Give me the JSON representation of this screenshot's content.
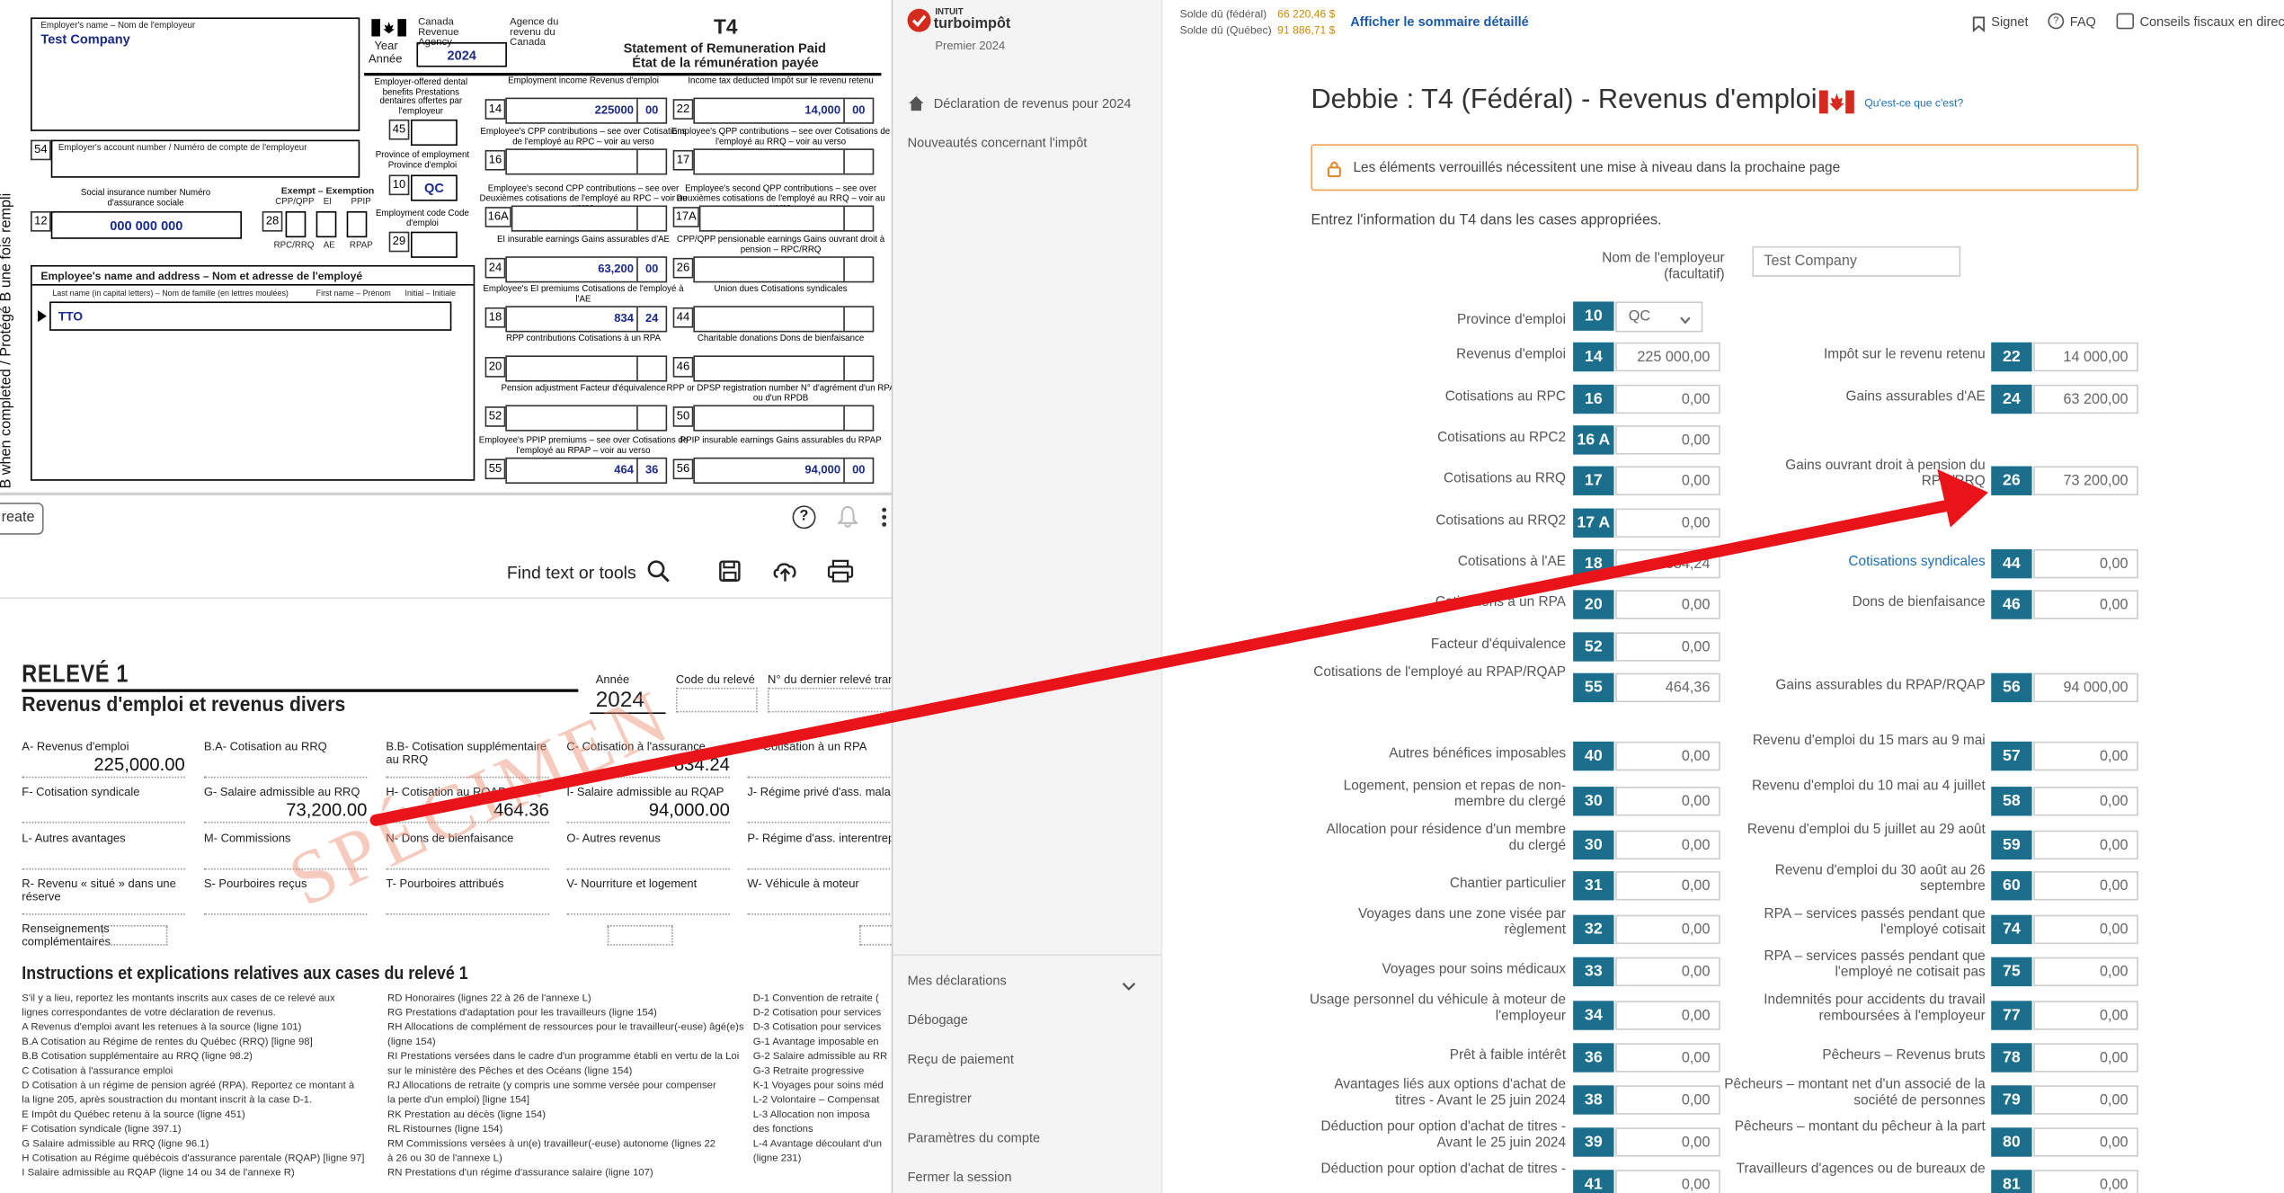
{
  "t4": {
    "employer_label": "Employer's name – Nom de l'employeur",
    "employer_name": "Test Company",
    "agency_en": "Canada Revenue Agency",
    "agency_fr": "Agence du revenu du Canada",
    "year_label_en": "Year",
    "year_label_fr": "Année",
    "year": "2024",
    "form_code": "T4",
    "title_en": "Statement of Remuneration Paid",
    "title_fr": "État de la rémunération payée",
    "side_text": "Protected B when completed / Protégé B une fois rempli",
    "account_label": "Employer's account number / Numéro de compte de l'employeur",
    "sin_label": "Social insurance number Numéro d'assurance sociale",
    "sin": "000 000 000",
    "exempt_label": "Exempt – Exemption",
    "exempt_cols": [
      "CPP/QPP",
      "EI",
      "PPIP"
    ],
    "exempt_cols_fr": [
      "RPC/RRQ",
      "AE",
      "RPAP"
    ],
    "dental_label": "Employer-offered dental benefits Prestations dentaires offertes par l'employeur",
    "province_label": "Province of employment Province d'emploi",
    "province": "QC",
    "empcode_label": "Employment code Code d'emploi",
    "name_addr_label": "Employee's name and address – Nom et adresse de l'employé",
    "lastname_label": "Last name (in capital letters) – Nom de famille (en lettres moulées)",
    "firstname_label": "First name – Prénom",
    "initial_label": "Initial – Initiale",
    "employee_lastname": "TTO",
    "boxes": [
      {
        "num": "14",
        "label": "Employment income Revenus d'emploi",
        "dollars": "225000",
        "cents": "00"
      },
      {
        "num": "22",
        "label": "Income tax deducted Impôt sur le revenu retenu",
        "dollars": "14,000",
        "cents": "00"
      },
      {
        "num": "16",
        "label": "Employee's CPP contributions – see over Cotisations de l'employé au RPC – voir au verso",
        "dollars": "",
        "cents": ""
      },
      {
        "num": "17",
        "label": "Employee's QPP contributions – see over Cotisations de l'employé au RRQ – voir au verso",
        "dollars": "",
        "cents": ""
      },
      {
        "num": "16A",
        "label": "Employee's second CPP contributions – see over Deuxièmes cotisations de l'employé au RPC – voir au verso",
        "dollars": "",
        "cents": ""
      },
      {
        "num": "17A",
        "label": "Employee's second QPP contributions – see over Deuxièmes cotisations de l'employé au RRQ – voir au verso",
        "dollars": "",
        "cents": ""
      },
      {
        "num": "24",
        "label": "EI insurable earnings Gains assurables d'AE",
        "dollars": "63,200",
        "cents": "00"
      },
      {
        "num": "26",
        "label": "CPP/QPP pensionable earnings Gains ouvrant droit à pension – RPC/RRQ",
        "dollars": "",
        "cents": ""
      },
      {
        "num": "18",
        "label": "Employee's EI premiums Cotisations de l'employé à l'AE",
        "dollars": "834",
        "cents": "24"
      },
      {
        "num": "44",
        "label": "Union dues Cotisations syndicales",
        "dollars": "",
        "cents": ""
      },
      {
        "num": "20",
        "label": "RPP contributions Cotisations à un RPA",
        "dollars": "",
        "cents": ""
      },
      {
        "num": "46",
        "label": "Charitable donations Dons de bienfaisance",
        "dollars": "",
        "cents": ""
      },
      {
        "num": "52",
        "label": "Pension adjustment Facteur d'équivalence",
        "dollars": "",
        "cents": ""
      },
      {
        "num": "50",
        "label": "RPP or DPSP registration number N° d'agrément d'un RPA ou d'un RPDB",
        "dollars": "",
        "cents": ""
      },
      {
        "num": "55",
        "label": "Employee's PPIP premiums – see over Cotisations de l'employé au RPAP – voir au verso",
        "dollars": "464",
        "cents": "36"
      },
      {
        "num": "56",
        "label": "PPIP insurable earnings Gains assurables du RPAP",
        "dollars": "94,000",
        "cents": "00"
      }
    ],
    "small_boxes": [
      "54",
      "12",
      "28",
      "45",
      "10",
      "29"
    ]
  },
  "viewer": {
    "create_label": "reate",
    "find_label": "Find text or tools"
  },
  "releve": {
    "title": "RELEVÉ 1",
    "subtitle": "Revenus d'emploi et revenus divers",
    "year_label": "Année",
    "year": "2024",
    "code_label": "Code du relevé",
    "last_label": "N° du dernier relevé trans",
    "watermark": "SPÉCIMEN",
    "fields": [
      {
        "label": "A- Revenus d'emploi",
        "value": "225,000.00"
      },
      {
        "label": "B.A- Cotisation au RRQ",
        "value": ""
      },
      {
        "label": "B.B- Cotisation supplémentaire au RRQ",
        "value": ""
      },
      {
        "label": "C- Cotisation à l'assurance",
        "value": "834.24"
      },
      {
        "label": "D- Cotisation à un RPA",
        "value": ""
      },
      {
        "label": "F- Cotisation syndicale",
        "value": ""
      },
      {
        "label": "G- Salaire admissible au RRQ",
        "value": "73,200.00"
      },
      {
        "label": "H- Cotisation au RQAP",
        "value": "464.36"
      },
      {
        "label": "I- Salaire admissible au RQAP",
        "value": "94,000.00"
      },
      {
        "label": "J- Régime privé d'ass. maladie",
        "value": ""
      },
      {
        "label": "L- Autres avantages",
        "value": ""
      },
      {
        "label": "M- Commissions",
        "value": ""
      },
      {
        "label": "N- Dons de bienfaisance",
        "value": ""
      },
      {
        "label": "O- Autres revenus",
        "value": ""
      },
      {
        "label": "P- Régime d'ass. interentrepri",
        "value": ""
      },
      {
        "label": "R- Revenu « situé » dans une réserve",
        "value": ""
      },
      {
        "label": "S- Pourboires reçus",
        "value": ""
      },
      {
        "label": "T- Pourboires attribués",
        "value": ""
      },
      {
        "label": "V- Nourriture et logement",
        "value": ""
      },
      {
        "label": "W- Véhicule à moteur",
        "value": ""
      }
    ],
    "extra_label": "Renseignements complémentaires",
    "instr_title": "Instructions et explications relatives aux cases du relevé 1",
    "instr_col1": [
      "S'il y a lieu, reportez les montants inscrits aux cases de ce relevé aux",
      "lignes correspondantes de votre déclaration de revenus.",
      "A    Revenus d'emploi avant les retenues à la source (ligne 101)",
      "B.A Cotisation au Régime de rentes du Québec (RRQ) [ligne 98]",
      "B.B Cotisation supplémentaire au RRQ (ligne 98.2)",
      "C    Cotisation à l'assurance emploi",
      "D    Cotisation à un régime de pension agréé (RPA). Reportez ce montant à",
      "      la ligne 205, après soustraction du montant inscrit à la case D-1.",
      "E    Impôt du Québec retenu à la source (ligne 451)",
      "F    Cotisation syndicale (ligne 397.1)",
      "G    Salaire admissible au RRQ (ligne 96.1)",
      "H    Cotisation au Régime québécois d'assurance parentale (RQAP) [ligne 97]",
      "I     Salaire admissible au RQAP (ligne 14 ou 34 de l'annexe R)"
    ],
    "instr_col2": [
      "RD  Honoraires (lignes 22 à 26 de l'annexe L)",
      "RG  Prestations d'adaptation pour les travailleurs (ligne 154)",
      "RH  Allocations de complément de ressources pour le travailleur(-euse) âgé(e)s",
      "       (ligne 154)",
      "RI   Prestations versées dans le cadre d'un programme établi en vertu de la Loi",
      "       sur le ministère des Pêches et des Océans (ligne 154)",
      "RJ   Allocations de retraite (y compris une somme versée pour compenser",
      "       la perte d'un emploi) [ligne 154]",
      "RK  Prestation au décès (ligne 154)",
      "RL   Ristournes (ligne 154)",
      "RM  Commissions versées à un(e) travailleur(-euse) autonome (lignes 22",
      "       à 26 ou 30 de l'annexe L)",
      "RN  Prestations d'un régime d'assurance salaire (ligne 107)"
    ],
    "instr_col3": [
      "D-1   Convention de retraite (",
      "D-2   Cotisation pour services",
      "D-3   Cotisation pour services",
      "G-1   Avantage imposable en",
      "G-2   Salaire admissible au RR",
      "G-3   Retraite progressive",
      "K-1   Voyages pour soins méd",
      "L-2   Volontaire – Compensat",
      "L-3   Allocation non imposa",
      "         des fonctions",
      "L-4   Avantage découlant d'un",
      "         (ligne 231)"
    ]
  },
  "turboimpot": {
    "brand_top": "INTUIT",
    "brand": "turboimpôt",
    "edition": "Premier 2024",
    "nav_top": [
      "Déclaration de revenus pour 2024",
      "Nouveautés concernant l'impôt"
    ],
    "nav_bottom": [
      "Mes déclarations",
      "Débogage",
      "Reçu de paiement",
      "Enregistrer",
      "Paramètres du compte",
      "Fermer la session"
    ],
    "balances": [
      {
        "label": "Solde dû (fédéral)",
        "value": "66 220,46 $"
      },
      {
        "label": "Solde dû (Québec)",
        "value": "91 886,71 $"
      }
    ],
    "summary_link": "Afficher le sommaire détaillé",
    "top_links": [
      "Signet",
      "FAQ",
      "Conseils fiscaux en direct"
    ],
    "page_title": "Debbie : T4 (Fédéral) - Revenus d'emploi",
    "whatis_link": "Qu'est-ce que c'est?",
    "alert": "Les éléments verrouillés nécessitent une mise à niveau dans la prochaine page",
    "intro": "Entrez l'information du T4 dans les cases appropriées.",
    "employer_label": "Nom de l'employeur (facultatif)",
    "employer_value": "Test Company",
    "province_label": "Province d'emploi",
    "province_box": "10",
    "province_value": "QC",
    "left_rows": [
      {
        "label": "Revenus d'emploi",
        "box": "14",
        "value": "225 000,00"
      },
      {
        "label": "Cotisations au RPC",
        "box": "16",
        "value": "0,00"
      },
      {
        "label": "Cotisations au RPC2",
        "box": "16 A",
        "value": "0,00"
      },
      {
        "label": "Cotisations au RRQ",
        "box": "17",
        "value": "0,00"
      },
      {
        "label": "Cotisations au RRQ2",
        "box": "17 A",
        "value": "0,00"
      },
      {
        "label": "Cotisations à l'AE",
        "box": "18",
        "value": "834,24"
      },
      {
        "label": "Cotisations à un RPA",
        "box": "20",
        "value": "0,00"
      },
      {
        "label": "Facteur d'équivalence",
        "box": "52",
        "value": "0,00"
      },
      {
        "label": "Cotisations de l'employé au RPAP/RQAP",
        "box": "55",
        "value": "464,36"
      },
      {
        "label": "Autres bénéfices imposables",
        "box": "40",
        "value": "0,00"
      },
      {
        "label": "Logement, pension et repas de non-membre du clergé",
        "box": "30",
        "value": "0,00"
      },
      {
        "label": "Allocation pour résidence d'un membre du clergé",
        "box": "30",
        "value": "0,00"
      },
      {
        "label": "Chantier particulier",
        "box": "31",
        "value": "0,00"
      },
      {
        "label": "Voyages dans une zone visée par règlement",
        "box": "32",
        "value": "0,00"
      },
      {
        "label": "Voyages pour soins médicaux",
        "box": "33",
        "value": "0,00"
      },
      {
        "label": "Usage personnel du véhicule à moteur de l'employeur",
        "box": "34",
        "value": "0,00"
      },
      {
        "label": "Prêt à faible intérêt",
        "box": "36",
        "value": "0,00"
      },
      {
        "label": "Avantages liés aux options d'achat de titres - Avant le 25 juin 2024",
        "box": "38",
        "value": "0,00"
      },
      {
        "label": "Déduction pour option d'achat de titres - Avant le 25 juin 2024",
        "box": "39",
        "value": "0,00"
      },
      {
        "label": "Déduction pour option d'achat de titres -",
        "box": "41",
        "value": "0,00"
      }
    ],
    "right_rows": [
      {
        "label": "Impôt sur le revenu retenu",
        "box": "22",
        "value": "14 000,00"
      },
      {
        "label": "Gains assurables d'AE",
        "box": "24",
        "value": "63 200,00"
      },
      {
        "label": "Gains ouvrant droit à pension du RPC/RRQ",
        "box": "26",
        "value": "73 200,00"
      },
      {
        "label": "Cotisations syndicales",
        "box": "44",
        "value": "0,00"
      },
      {
        "label": "Dons de bienfaisance",
        "box": "46",
        "value": "0,00"
      },
      {
        "label": "Gains assurables du RPAP/RQAP",
        "box": "56",
        "value": "94 000,00"
      },
      {
        "label": "Revenu d'emploi du 15 mars au 9 mai",
        "box": "57",
        "value": "0,00"
      },
      {
        "label": "Revenu d'emploi du 10 mai au 4 juillet",
        "box": "58",
        "value": "0,00"
      },
      {
        "label": "Revenu d'emploi du 5 juillet au 29 août",
        "box": "59",
        "value": "0,00"
      },
      {
        "label": "Revenu d'emploi du 30 août au 26 septembre",
        "box": "60",
        "value": "0,00"
      },
      {
        "label": "RPA – services passés pendant que l'employé cotisait",
        "box": "74",
        "value": "0,00"
      },
      {
        "label": "RPA – services passés pendant que l'employé ne cotisait pas",
        "box": "75",
        "value": "0,00"
      },
      {
        "label": "Indemnités pour accidents du travail remboursées à l'employeur",
        "box": "77",
        "value": "0,00"
      },
      {
        "label": "Pêcheurs – Revenus bruts",
        "box": "78",
        "value": "0,00"
      },
      {
        "label": "Pêcheurs – montant net d'un associé de la société de personnes",
        "box": "79",
        "value": "0,00"
      },
      {
        "label": "Pêcheurs – montant du pêcheur à la part",
        "box": "80",
        "value": "0,00"
      },
      {
        "label": "Travailleurs d'agences ou de bureaux de",
        "box": "81",
        "value": "0,00"
      }
    ],
    "accent": "#1b6f8c",
    "alert_border": "#f0a050",
    "arrow_color": "#e8141a"
  }
}
